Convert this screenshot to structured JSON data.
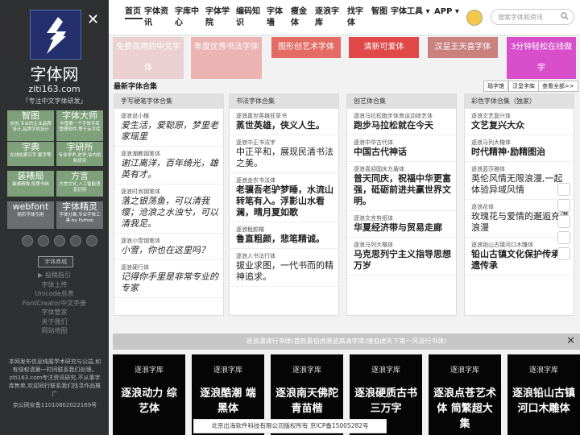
{
  "sidebar": {
    "brand_title": "字体网",
    "brand_url": "ziti163.com",
    "slogan": "「专注中文字体研发」",
    "close": "✕",
    "tiles": [
      {
        "title": "智图",
        "desc": "自创,专业的企业品牌设计,品牌字体设计"
      },
      {
        "title": "字体大师",
        "desc": "中国第一个字体字库管理软件,等于云字库"
      },
      {
        "title": "字典",
        "desc": "在线检索汉字·繁字等"
      },
      {
        "title": "字研所",
        "desc": "专业学术,史学,业内创新研究"
      },
      {
        "title": "装裱局",
        "desc": "装裱精致,优质书画"
      },
      {
        "title": "方言",
        "desc": "方言文化,人工智能语音识别"
      },
      {
        "title": "webfont",
        "desc": "网页字体引用"
      },
      {
        "title": "字体精灵",
        "desc": "字体分离,专业字体工具 by Python"
      }
    ],
    "select_label": "字体商城",
    "links": [
      "▶ 投稿指引",
      "字体上传",
      "Unicode总表",
      "FontCreator中文手册",
      "字体管家",
      "关于我们",
      "网站地图"
    ],
    "note": "本网发布信息纯属学术研究与公益,如有侵权请第一时间联系我们处理。ziti163.com专注资讯研究,不从事字库售卖,欢迎同行联系我们找寻作品推广",
    "icp": "京公网安备11010802022169号"
  },
  "nav": {
    "items": [
      "首页",
      "字体资讯",
      "字库中心",
      "字体学院",
      "编码知识",
      "字体墙",
      "瘦金体",
      "逐浪字库",
      "找字体",
      "智图",
      "字体工具",
      "APP"
    ],
    "search_placeholder": "搜索字体和资讯"
  },
  "banners": [
    {
      "text": "免费商用的中文字体",
      "color": "#ead0d0"
    },
    {
      "text": "年度优秀书法字体",
      "color": "#ecb3b3"
    },
    {
      "text": "图形创艺术字体",
      "color": "#e36b64"
    },
    {
      "text": "清新可爱体",
      "color": "#e14848"
    },
    {
      "text": "汉呈王天喜字体",
      "color": "#cb8080"
    },
    {
      "text": "3分钟轻松在线做字",
      "color": "#d94fcb"
    }
  ],
  "section": {
    "title": "最新字体合集",
    "buttons": [
      "瑙字馆",
      "汉呈字库",
      "查看全部>>"
    ]
  },
  "columns": [
    {
      "header": "手写硬笔字体合集",
      "items": [
        {
          "name": "逐浪说小楷",
          "sample": "爱生活，爱聪原，梦里老家瑶里"
        },
        {
          "name": "逐浪潮教钢笔体",
          "sample": "谢江离洋，百年绮光，雄英有才。"
        },
        {
          "name": "逐浪时尚钢笔体",
          "sample": "落之银荡鱼，可以清我缨；沧浪之水浊兮，可以清我足。"
        },
        {
          "name": "逐浪小雪钢笔体",
          "sample": "小雪，你也在这里吗？"
        },
        {
          "name": "逐浪硬行体",
          "sample": "记得你手里是非常专业的专家"
        }
      ]
    },
    {
      "header": "书法字体合集",
      "items": [
        {
          "name": "逐浪嘉世英雄狂草书",
          "sample": "蒸世英雄，侠义人生。"
        },
        {
          "name": "逐浪中正书法字",
          "sample": "中正平和，展现民清书法之美。"
        },
        {
          "name": "逐浪金农书法体",
          "sample": "老骥吾老驴梦睡，水流山转笔有入。浮影山水看澜，晴月夏如歌"
        },
        {
          "name": "逐浪粗颜楷",
          "sample": "鲁直粗颜，悲笔精诚。"
        },
        {
          "name": "逐浪人书法行体",
          "sample": "拔业求图，一代书而的精神追求。"
        }
      ]
    },
    {
      "header": "创艺体合集",
      "items": [
        {
          "name": "逐浪马拉松跑步体育运动综艺体",
          "sample": "跑步马拉松就在今天"
        },
        {
          "name": "逐浪中华古代体",
          "sample": "中国古代神话"
        },
        {
          "name": "逐浪喜迎国庆方盾体",
          "sample": "普天同庆，祝福中华更富强，砥砺前进共赢世界文明。"
        },
        {
          "name": "逐浪文言剪纸体",
          "sample": "华夏经济带与贸易走廊"
        },
        {
          "name": "逐浪马列大楷体",
          "sample": "马克思列宁主义指导思想万岁"
        }
      ]
    },
    {
      "header": "彩色字体合集（独家）",
      "items": [
        {
          "name": "逐浪文艺复兴体",
          "sample": "文艺复兴大众"
        },
        {
          "name": "逐浪马列大楷体",
          "sample": "时代精神·励精图治"
        },
        {
          "name": "逐浪蓝莎雅体",
          "sample": "英伦风情无限浪漫,一起体验异域风情"
        },
        {
          "name": "逐浪花体",
          "sample": "玫瑰花与爱情的邂逅充满浪漫"
        },
        {
          "name": "逐浪铂山古镇河口木雕体",
          "sample": "铅山古镇文化保护传承非遗传承"
        }
      ]
    }
  ],
  "bottom": {
    "bar_text": "逐浪漂清行书体(首款慕伯虎原迹高清字库/唐伯虎天下第一风流行书体)",
    "close": "✕",
    "cards": [
      {
        "label": "逐浪字库",
        "title": "逐浪动力 综艺体"
      },
      {
        "label": "逐浪字库",
        "title": "逐浪酷潮 端黑体"
      },
      {
        "label": "逐浪字库",
        "title": "逐浪南天佛陀 青苗楷"
      },
      {
        "label": "逐浪字库",
        "title": "逐浪硬质古书 三万字"
      },
      {
        "label": "逐浪字库",
        "title": "逐浪点苍艺术体 简繁超大集"
      },
      {
        "label": "逐浪字库",
        "title": "逐浪铅山古镇 河口木雕体"
      }
    ],
    "copyright": "北京出海软件科技有限公司版权所有 京ICP备15005282号"
  }
}
